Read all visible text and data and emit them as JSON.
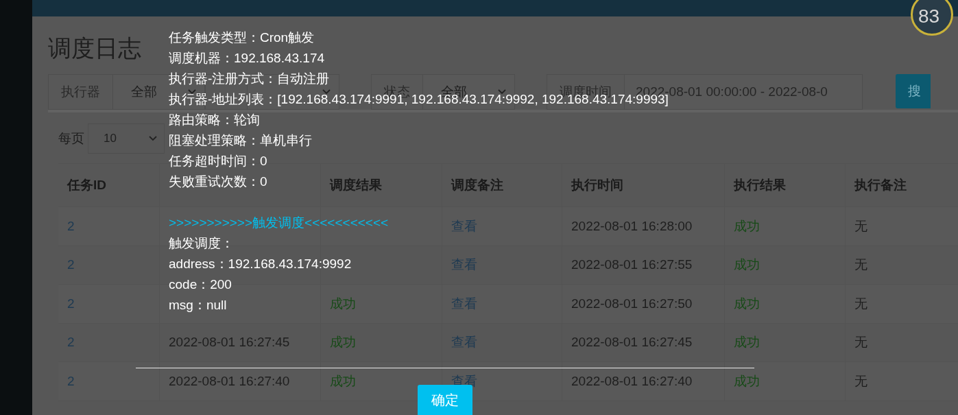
{
  "badge": {
    "text": "83"
  },
  "page_title": "调度日志",
  "filters": [
    {
      "label": "执行器",
      "value": "全部",
      "kind": "select"
    },
    {
      "kind": "select"
    },
    {
      "label": "状态",
      "value": "全部",
      "kind": "select"
    },
    {
      "label": "调度时间",
      "value": "2022-08-01 00:00:00 - 2022-08-0",
      "kind": "input"
    }
  ],
  "search_button": "搜",
  "page_size": {
    "label": "每页",
    "value": "10"
  },
  "table": {
    "columns": [
      "任务ID",
      null,
      "调度结果",
      "调度备注",
      "执行时间",
      "执行结果",
      "执行备注"
    ],
    "rows": [
      [
        "2",
        null,
        null,
        "查看",
        "2022-08-01 16:28:00",
        "成功",
        "无"
      ],
      [
        "2",
        null,
        null,
        "查看",
        "2022-08-01 16:27:55",
        "成功",
        "无"
      ],
      [
        "2",
        null,
        "成功",
        "查看",
        "2022-08-01 16:27:50",
        "成功",
        "无"
      ],
      [
        "2",
        "2022-08-01 16:27:45",
        "成功",
        "查看",
        "2022-08-01 16:27:45",
        "成功",
        "无"
      ],
      [
        "2",
        "2022-08-01 16:27:40",
        "成功",
        "查看",
        "2022-08-01 16:27:40",
        "成功",
        "无"
      ]
    ]
  },
  "dialog": {
    "lines": [
      {
        "kind": "text",
        "text": "任务触发类型：Cron触发"
      },
      {
        "kind": "text",
        "text": "调度机器：192.168.43.174"
      },
      {
        "kind": "text",
        "text": "执行器-注册方式：自动注册"
      },
      {
        "kind": "text",
        "text": "执行器-地址列表：[192.168.43.174:9991, 192.168.43.174:9992, 192.168.43.174:9993]"
      },
      {
        "kind": "text",
        "text": "路由策略：轮询"
      },
      {
        "kind": "text",
        "text": "阻塞处理策略：单机串行"
      },
      {
        "kind": "text",
        "text": "任务超时时间：0"
      },
      {
        "kind": "text",
        "text": "失败重试次数：0"
      },
      {
        "kind": "heading",
        "text": ">>>>>>>>>>>触发调度<<<<<<<<<<<"
      },
      {
        "kind": "text",
        "text": "触发调度："
      },
      {
        "kind": "text",
        "text": "address：192.168.43.174:9992"
      },
      {
        "kind": "text",
        "text": "code：200"
      },
      {
        "kind": "text",
        "text": "msg：null"
      }
    ],
    "button": "确定"
  }
}
